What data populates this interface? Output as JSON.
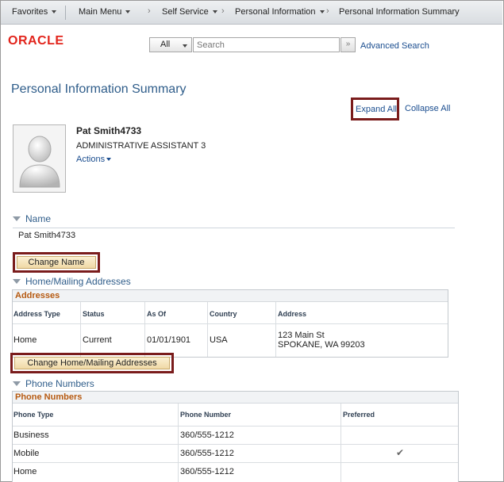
{
  "nav": {
    "favorites": "Favorites",
    "main_menu": "Main Menu",
    "self_service": "Self Service",
    "personal_information": "Personal Information",
    "current_page": "Personal Information Summary",
    "separator_icon": "chevron-right-icon"
  },
  "header": {
    "logo": "ORACLE",
    "search_scope": "All",
    "search_placeholder": "Search",
    "search_go_icon": "double-chevron-right-icon",
    "advanced_search": "Advanced Search"
  },
  "page": {
    "title": "Personal Information Summary",
    "expand_all": "Expand All",
    "collapse_all": "Collapse All"
  },
  "employee": {
    "name": "Pat Smith4733",
    "job_title": "ADMINISTRATIVE ASSISTANT 3",
    "actions": "Actions"
  },
  "name_section": {
    "header": "Name",
    "value": "Pat Smith4733",
    "change_button": "Change Name"
  },
  "address_section": {
    "header": "Home/Mailing Addresses",
    "grid_title": "Addresses",
    "columns": [
      "Address Type",
      "Status",
      "As Of",
      "Country",
      "Address"
    ],
    "rows": [
      {
        "type": "Home",
        "status": "Current",
        "as_of": "01/01/1901",
        "country": "USA",
        "address_line1": "123 Main St",
        "address_line2": "SPOKANE, WA 99203"
      }
    ],
    "change_button": "Change Home/Mailing Addresses"
  },
  "phone_section": {
    "header": "Phone Numbers",
    "grid_title": "Phone Numbers",
    "columns": [
      "Phone Type",
      "Phone Number",
      "Preferred"
    ],
    "rows": [
      {
        "type": "Business",
        "number": "360/555-1212",
        "preferred": false
      },
      {
        "type": "Mobile",
        "number": "360/555-1212",
        "preferred": true
      },
      {
        "type": "Home",
        "number": "360/555-1212",
        "preferred": false
      }
    ],
    "preferred_icon": "checkmark-icon"
  },
  "colors": {
    "link": "#1a4d8f",
    "section_header": "#2f5d8a",
    "grid_title": "#b65a11",
    "highlight_border": "#7a1c1c",
    "oracle_red": "#e2241b"
  }
}
